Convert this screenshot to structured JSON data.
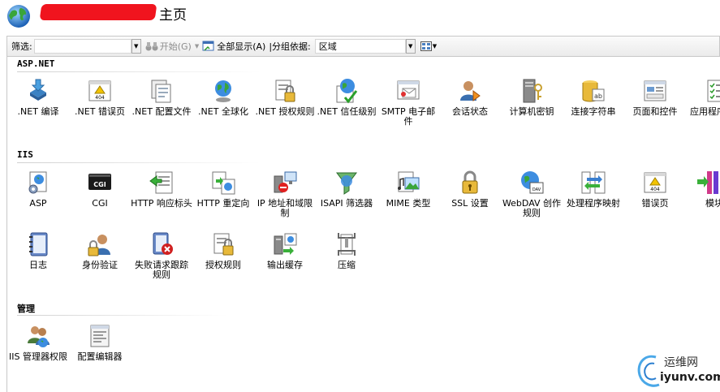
{
  "header": {
    "title": "主页"
  },
  "toolbar": {
    "filter_label": "筛选:",
    "filter_value": "",
    "go_label": "开始(G)",
    "show_all_label": "全部显示(A)",
    "group_by_label": "|分组依据:",
    "group_by_value": "区域"
  },
  "sections": [
    {
      "title": "ASP.NET",
      "items": [
        {
          "label": ".NET 编译",
          "icon": "net-compile-icon"
        },
        {
          "label": ".NET 错误页",
          "icon": "net-error-page-icon"
        },
        {
          "label": ".NET 配置文件",
          "icon": "net-profile-icon"
        },
        {
          "label": ".NET 全球化",
          "icon": "net-globalization-icon"
        },
        {
          "label": ".NET 授权规则",
          "icon": "net-authorization-icon"
        },
        {
          "label": ".NET 信任级别",
          "icon": "net-trust-level-icon"
        },
        {
          "label": "SMTP 电子邮件",
          "icon": "smtp-email-icon"
        },
        {
          "label": "会话状态",
          "icon": "session-state-icon"
        },
        {
          "label": "计算机密钥",
          "icon": "machine-key-icon"
        },
        {
          "label": "连接字符串",
          "icon": "connection-strings-icon"
        },
        {
          "label": "页面和控件",
          "icon": "pages-controls-icon"
        },
        {
          "label": "应用程序设置",
          "icon": "app-settings-icon"
        }
      ]
    },
    {
      "title": "IIS",
      "items": [
        {
          "label": "ASP",
          "icon": "asp-icon"
        },
        {
          "label": "CGI",
          "icon": "cgi-icon",
          "badge": "CGI"
        },
        {
          "label": "HTTP 响应标头",
          "icon": "http-response-headers-icon"
        },
        {
          "label": "HTTP 重定向",
          "icon": "http-redirect-icon"
        },
        {
          "label": "IP 地址和域限制",
          "icon": "ip-domain-restrictions-icon"
        },
        {
          "label": "ISAPI 筛选器",
          "icon": "isapi-filters-icon"
        },
        {
          "label": "MIME 类型",
          "icon": "mime-types-icon"
        },
        {
          "label": "SSL 设置",
          "icon": "ssl-settings-icon"
        },
        {
          "label": "WebDAV 创作规则",
          "icon": "webdav-icon",
          "badge": "DAV"
        },
        {
          "label": "处理程序映射",
          "icon": "handler-mappings-icon"
        },
        {
          "label": "错误页",
          "icon": "error-pages-icon",
          "badge": "404"
        },
        {
          "label": "模块",
          "icon": "modules-icon"
        },
        {
          "label": "日志",
          "icon": "logging-icon"
        },
        {
          "label": "身份验证",
          "icon": "authentication-icon"
        },
        {
          "label": "失败请求跟踪规则",
          "icon": "failed-request-tracing-icon"
        },
        {
          "label": "授权规则",
          "icon": "authorization-rules-icon"
        },
        {
          "label": "输出缓存",
          "icon": "output-caching-icon"
        },
        {
          "label": "压缩",
          "icon": "compression-icon"
        }
      ]
    },
    {
      "title": "管理",
      "items": [
        {
          "label": "IIS 管理器权限",
          "icon": "iis-manager-permissions-icon"
        },
        {
          "label": "配置编辑器",
          "icon": "configuration-editor-icon"
        }
      ]
    }
  ],
  "badges": {
    "error_404": "404"
  },
  "watermark": {
    "line1": "运维网",
    "line2": "iyunv.com"
  },
  "colors": {
    "redaction": "#f0141e",
    "accent_blue": "#1f6fc4",
    "folder_yellow": "#e8b93a"
  }
}
